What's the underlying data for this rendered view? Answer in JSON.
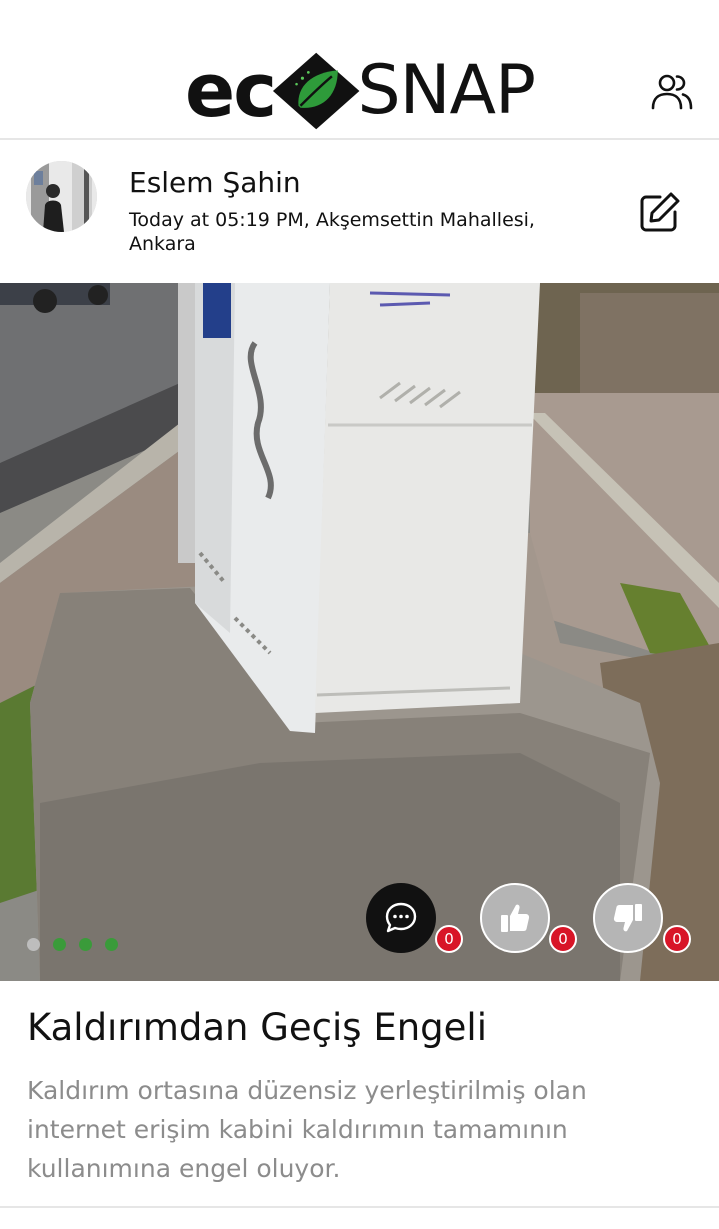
{
  "header": {
    "logo_left": "ec",
    "logo_right": "SNAP",
    "icons": {
      "users": "users-icon"
    },
    "colors": {
      "logo_green": "#2e9b3a",
      "logo_dark": "#111111"
    }
  },
  "post": {
    "author": "Eslem Şahin",
    "meta": "Today at 05:19 PM, Akşemsettin Mahallesi, Ankara",
    "icons": {
      "edit": "edit-icon"
    },
    "carousel": {
      "count": 4,
      "active_index": 0,
      "active_color": "#bdbdbd",
      "inactive_color": "#3a9b3a"
    },
    "actions": {
      "comment_count": "0",
      "like_count": "0",
      "dislike_count": "0",
      "icons": {
        "comment": "comment-icon",
        "like": "thumbs-up-icon",
        "dislike": "thumbs-down-icon"
      }
    },
    "title": "Kaldırımdan Geçiş Engeli",
    "description": "Kaldırım ortasına düzensiz yerleştirilmiş olan internet erişim kabini kaldırımın tamamının kullanımına engel oluyor."
  },
  "colors": {
    "badge": "#d81527"
  }
}
